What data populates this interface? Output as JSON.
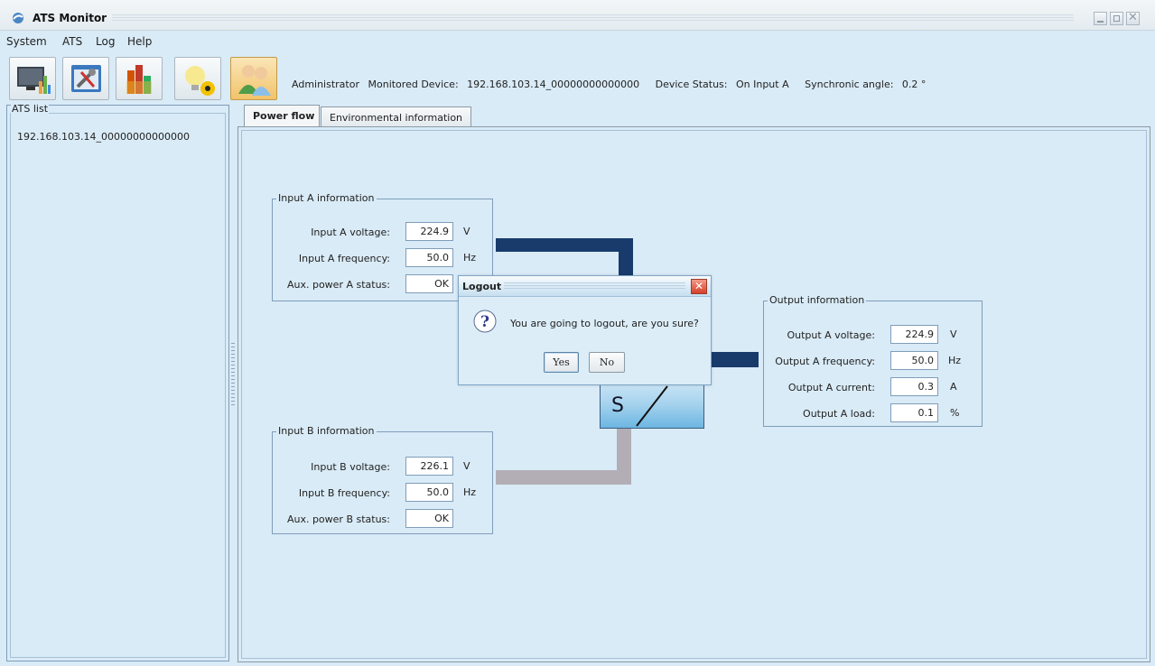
{
  "window": {
    "title": "ATS Monitor"
  },
  "menu": [
    "System",
    "ATS",
    "Log",
    "Help"
  ],
  "toolbar": {
    "buttons": [
      {
        "name": "monitor-icon"
      },
      {
        "name": "tools-icon"
      },
      {
        "name": "chart-icon"
      },
      {
        "name": "alarm-bulb-icon"
      },
      {
        "name": "users-icon"
      }
    ],
    "status": {
      "user": "Administrator",
      "monitored_label": "Monitored Device:",
      "monitored_value": "192.168.103.14_00000000000000",
      "device_status_label": "Device Status:",
      "device_status_value": "On Input A",
      "sync_angle_label": "Synchronic angle:",
      "sync_angle_value": "0.2 °"
    }
  },
  "ats_list": {
    "title": "ATS list",
    "items": [
      "192.168.103.14_00000000000000"
    ]
  },
  "tabs": [
    "Power flow",
    "Environmental information"
  ],
  "input_a": {
    "title": "Input A information",
    "voltage_label": "Input A voltage:",
    "voltage": "224.9",
    "voltage_unit": "V",
    "freq_label": "Input A frequency:",
    "freq": "50.0",
    "freq_unit": "Hz",
    "aux_label": "Aux. power A status:",
    "aux": "OK"
  },
  "input_b": {
    "title": "Input B information",
    "voltage_label": "Input B voltage:",
    "voltage": "226.1",
    "voltage_unit": "V",
    "freq_label": "Input B frequency:",
    "freq": "50.0",
    "freq_unit": "Hz",
    "aux_label": "Aux. power B status:",
    "aux": "OK"
  },
  "output": {
    "title": "Output information",
    "voltage_label": "Output A voltage:",
    "voltage": "224.9",
    "voltage_unit": "V",
    "freq_label": "Output A frequency:",
    "freq": "50.0",
    "freq_unit": "Hz",
    "current_label": "Output A current:",
    "current": "0.3",
    "current_unit": "A",
    "load_label": "Output A load:",
    "load": "0.1",
    "load_unit": "%"
  },
  "switch_box": {
    "letter": "S"
  },
  "dialog": {
    "title": "Logout",
    "message": "You are going to logout, are you sure?",
    "yes": "Yes",
    "no": "No"
  },
  "colors": {
    "active_line": "#193b6c",
    "inactive_line": "#b3aeb6",
    "background": "#d9ebf7"
  }
}
